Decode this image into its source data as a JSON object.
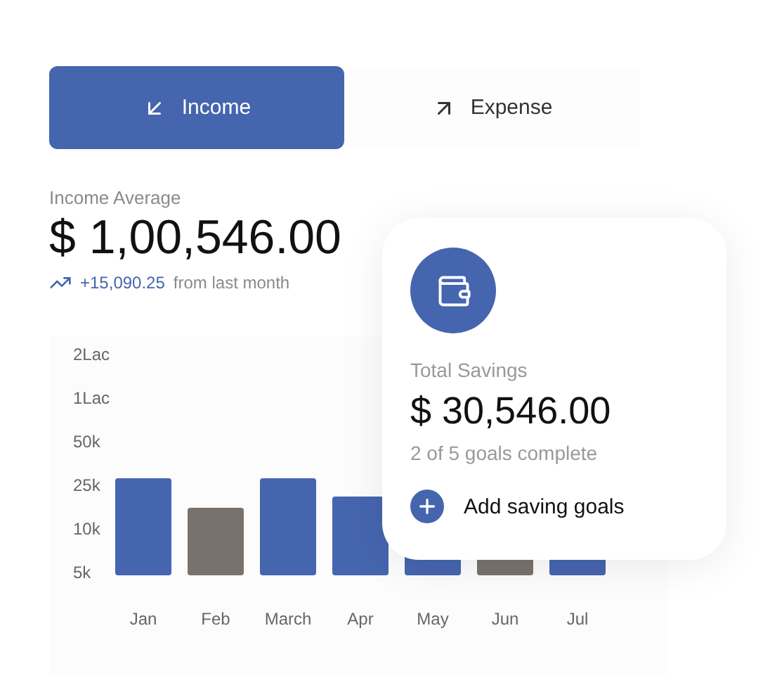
{
  "tabs": [
    {
      "label": "Income",
      "selected": true,
      "kind": "income"
    },
    {
      "label": "Expense",
      "selected": false,
      "kind": "expense"
    }
  ],
  "summary": {
    "label": "Income Average",
    "amount": "$ 1,00,546.00",
    "change": "+15,090.25",
    "change_note": "from last month"
  },
  "chart": {
    "axis_labels": [
      "2Lac",
      "1Lac",
      "50k",
      "25k",
      "10k",
      "5k"
    ],
    "bars": [
      {
        "month": "Jan",
        "color": "#4565ae"
      },
      {
        "month": "Feb",
        "color": "#78716c"
      },
      {
        "month": "March",
        "color": "#4565ae"
      },
      {
        "month": "Apr",
        "color": "#4565ae"
      },
      {
        "month": "May",
        "color": "#4565ae"
      },
      {
        "month": "Jun",
        "color": "#78716c"
      },
      {
        "month": "Jul",
        "color": "#4565ae"
      }
    ]
  },
  "savings_card": {
    "label": "Total Savings",
    "amount": "$ 30,546.00",
    "progress": "2 of 5 goals complete",
    "action": "Add saving goals"
  }
}
